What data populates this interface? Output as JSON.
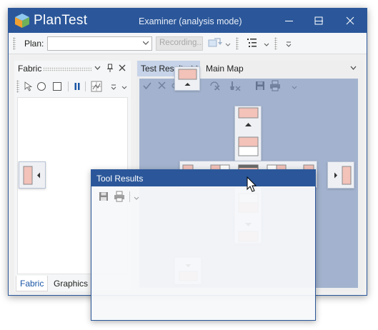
{
  "app": {
    "name": "PlanTest",
    "window_title": "Examiner (analysis mode)",
    "accent_color": "#2b579a",
    "icons": [
      "app-logo-cube-icon",
      "minimize-icon",
      "maximize-icon",
      "close-icon"
    ]
  },
  "toolbar": {
    "plan_label": "Plan:",
    "plan_value": "",
    "recording_label": "Recording...",
    "icons": [
      "record-icon",
      "list-icon",
      "overflow-icon"
    ]
  },
  "fabric_panel": {
    "title": "Fabric",
    "tabs": [
      "Fabric",
      "Graphics"
    ],
    "active_tab": "Fabric",
    "tools": [
      "select-icon",
      "circle-icon",
      "square-icon",
      "pause-icon",
      "grid-icon"
    ]
  },
  "document": {
    "tabs": [
      "Test Results",
      "Main Map"
    ],
    "active_tab": "Test Results",
    "tools": [
      "check-icon",
      "close-icon",
      "link-icon",
      "clear-icon",
      "filter-icon",
      "save-icon",
      "print-icon"
    ]
  },
  "floating_window": {
    "title": "Tool Results",
    "tools": [
      "save-icon",
      "print-icon"
    ]
  },
  "dock_guides": {
    "preview_color": "#5878b0",
    "positions": [
      "top",
      "bottom",
      "left",
      "right",
      "center",
      "outer-left",
      "outer-right",
      "outer-top",
      "outer-bottom"
    ]
  }
}
